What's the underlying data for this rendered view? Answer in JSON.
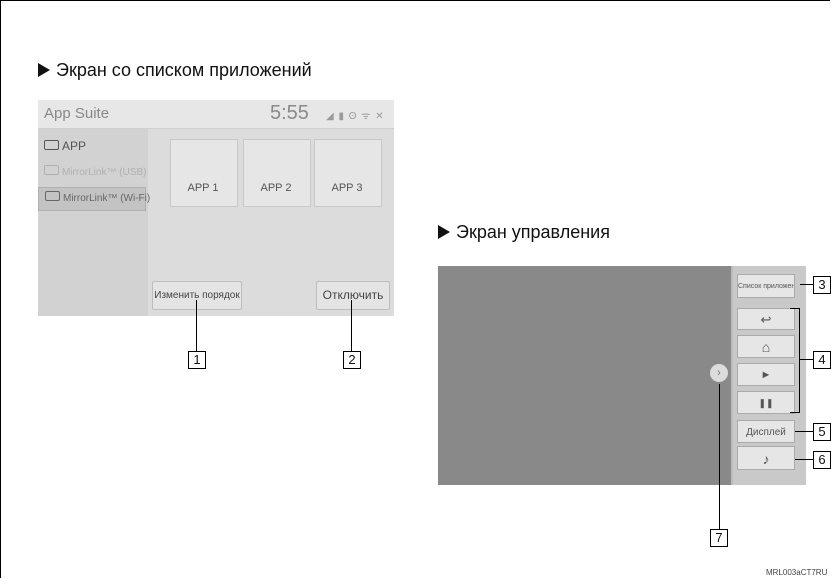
{
  "sections": {
    "app_list_title": "Экран со списком приложений",
    "control_title": "Экран управления"
  },
  "app_screen": {
    "title": "App Suite",
    "time": "5:55",
    "status_icons": "◢ ▮ ʘ ᯤ ✕",
    "side_items": [
      "APP",
      "MirrorLink™ (USB)",
      "MirrorLink™ (Wi-Fi)"
    ],
    "tiles": [
      "APP 1",
      "APP 2",
      "APP 3"
    ],
    "reorder_button": "Изменить порядок",
    "disconnect_button": "Отключить"
  },
  "control_screen": {
    "app_list_button": "Список приложений",
    "back_icon": "↩",
    "home_icon": "⌂",
    "play_icon": "►",
    "pause_icon": "❚❚",
    "display_button": "Дисплей",
    "music_icon": "♪",
    "expand_icon": "›"
  },
  "callouts": [
    "1",
    "2",
    "3",
    "4",
    "5",
    "6",
    "7"
  ],
  "watermark": "MRL003aCT7RU"
}
